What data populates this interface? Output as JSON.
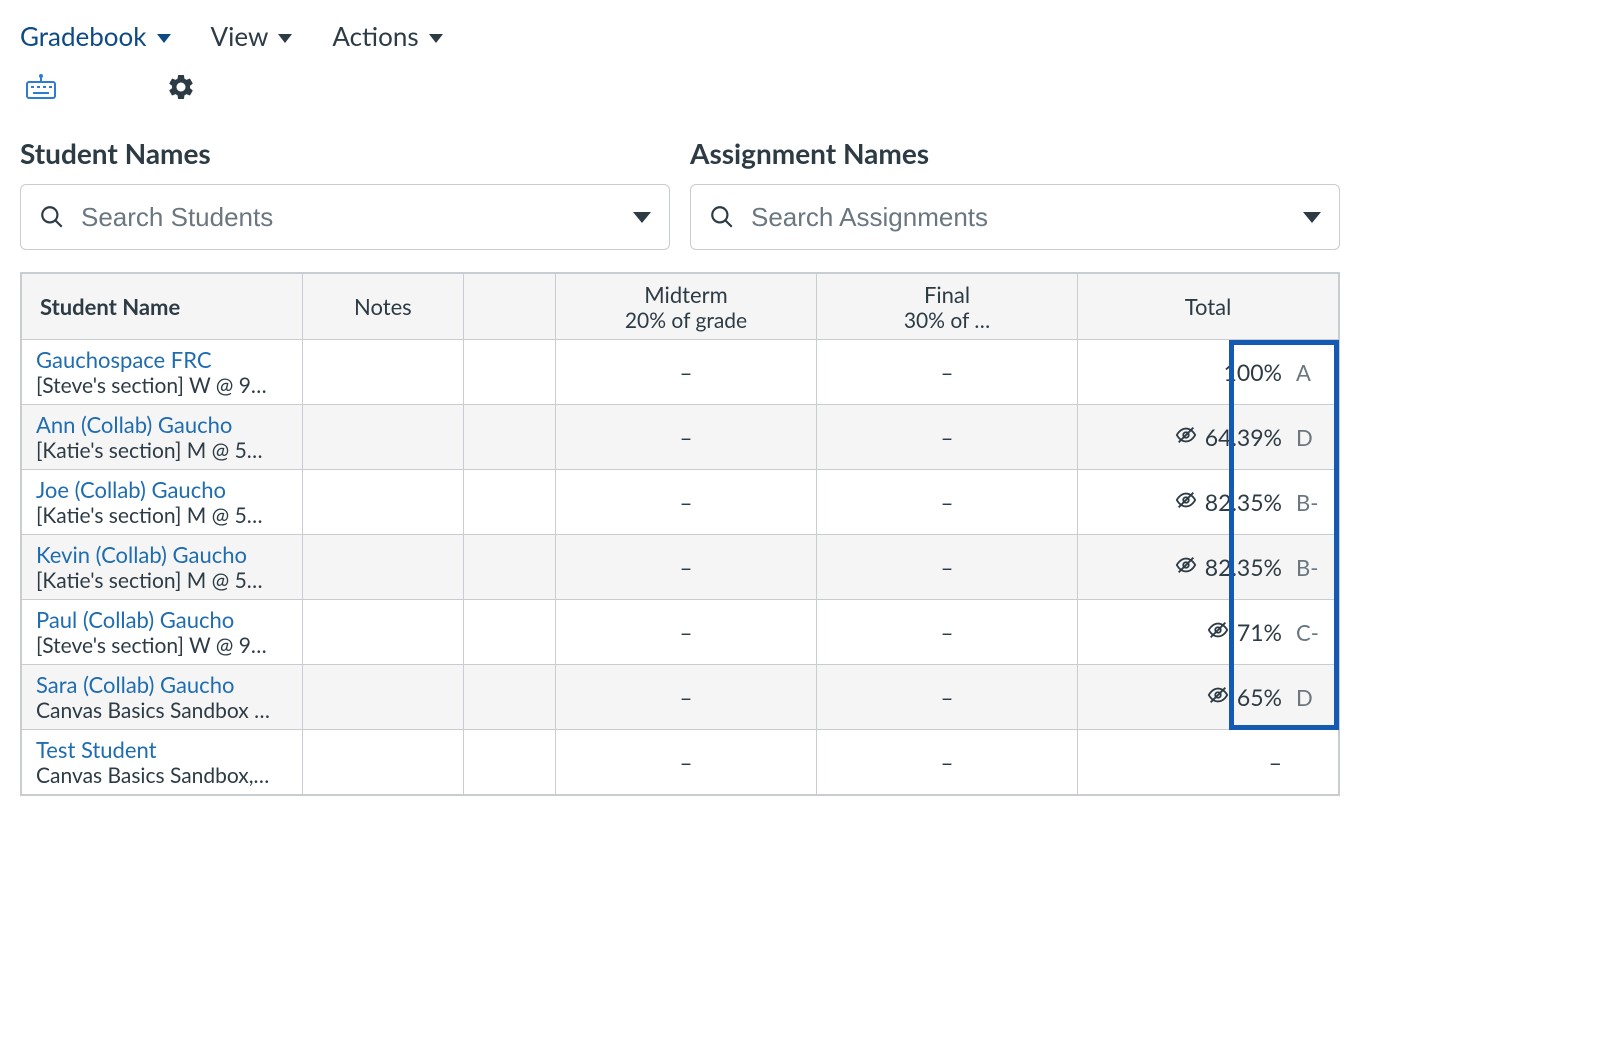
{
  "toolbar": {
    "gradebook": "Gradebook",
    "view": "View",
    "actions": "Actions"
  },
  "search": {
    "students_label": "Student Names",
    "students_placeholder": "Search Students",
    "assignments_label": "Assignment Names",
    "assignments_placeholder": "Search Assignments"
  },
  "columns": {
    "student": "Student Name",
    "notes": "Notes",
    "midterm_title": "Midterm",
    "midterm_sub": "20% of grade",
    "final_title": "Final",
    "final_sub": "30% of …",
    "total": "Total"
  },
  "rows": [
    {
      "name": "Gauchospace FRC",
      "section": "[Steve's section] W @ 9…",
      "midterm": "–",
      "final": "–",
      "hidden": false,
      "pct": "100%",
      "letter": "A"
    },
    {
      "name": "Ann (Collab) Gaucho",
      "section": "[Katie's section] M @ 5…",
      "midterm": "–",
      "final": "–",
      "hidden": true,
      "pct": "64.39%",
      "letter": "D"
    },
    {
      "name": "Joe (Collab) Gaucho",
      "section": "[Katie's section] M @ 5…",
      "midterm": "–",
      "final": "–",
      "hidden": true,
      "pct": "82.35%",
      "letter": "B-"
    },
    {
      "name": "Kevin (Collab) Gaucho",
      "section": "[Katie's section] M @ 5…",
      "midterm": "–",
      "final": "–",
      "hidden": true,
      "pct": "82.35%",
      "letter": "B-"
    },
    {
      "name": "Paul (Collab) Gaucho",
      "section": "[Steve's section] W @ 9…",
      "midterm": "–",
      "final": "–",
      "hidden": true,
      "pct": "71%",
      "letter": "C-"
    },
    {
      "name": "Sara (Collab) Gaucho",
      "section": "Canvas Basics Sandbox …",
      "midterm": "–",
      "final": "–",
      "hidden": true,
      "pct": "65%",
      "letter": "D"
    },
    {
      "name": "Test Student",
      "section": "Canvas Basics Sandbox,…",
      "midterm": "–",
      "final": "–",
      "hidden": false,
      "pct": "–",
      "letter": ""
    }
  ]
}
